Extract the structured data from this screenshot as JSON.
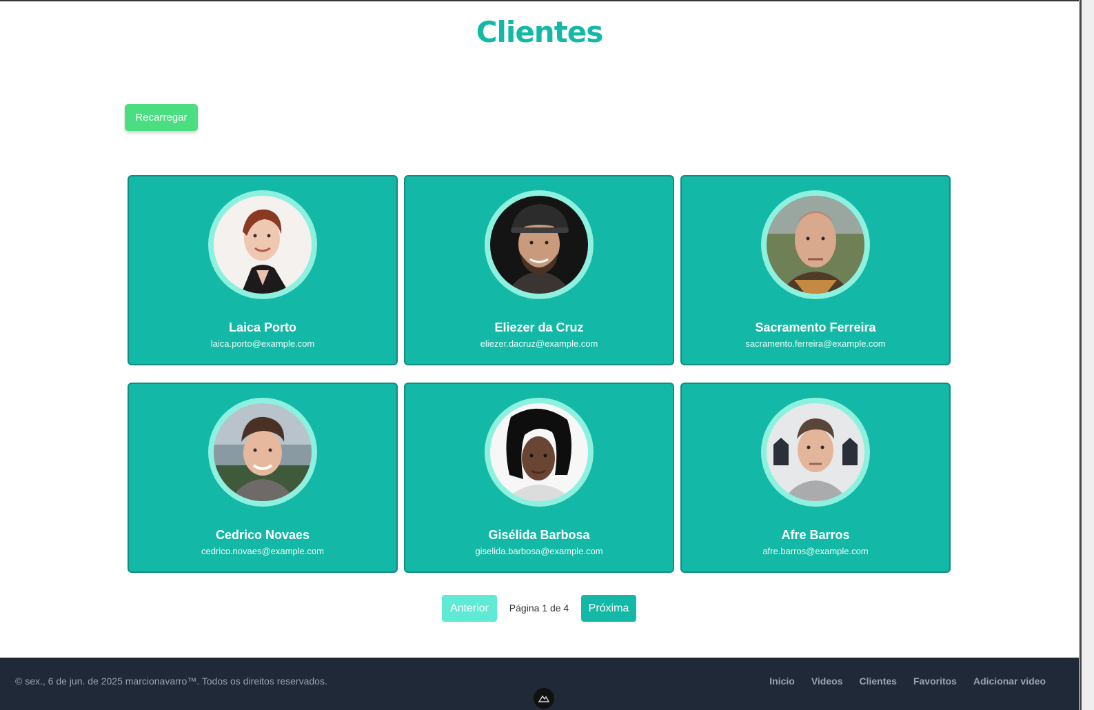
{
  "header": {
    "title": "Clientes"
  },
  "actions": {
    "reload_label": "Recarregar"
  },
  "clients": [
    {
      "name": "Laica Porto",
      "email": "laica.porto@example.com"
    },
    {
      "name": "Eliezer da Cruz",
      "email": "eliezer.dacruz@example.com"
    },
    {
      "name": "Sacramento Ferreira",
      "email": "sacramento.ferreira@example.com"
    },
    {
      "name": "Cedrico Novaes",
      "email": "cedrico.novaes@example.com"
    },
    {
      "name": "Gisélida Barbosa",
      "email": "giselida.barbosa@example.com"
    },
    {
      "name": "Afre Barros",
      "email": "afre.barros@example.com"
    }
  ],
  "pagination": {
    "prev_label": "Anterior",
    "info": "Página 1 de 4",
    "next_label": "Próxima"
  },
  "footer": {
    "copyright": "© sex., 6 de jun. de 2025 marcionavarro™. Todos os direitos reservados.",
    "links": [
      "Inicio",
      "Videos",
      "Clientes",
      "Favoritos",
      "Adicionar video"
    ]
  },
  "colors": {
    "accent": "#14b8a6",
    "accent_light": "#5eead4",
    "reload": "#4ade80",
    "footer_bg": "#1f2937"
  },
  "icons": {
    "footer_fab": "logo-icon"
  }
}
